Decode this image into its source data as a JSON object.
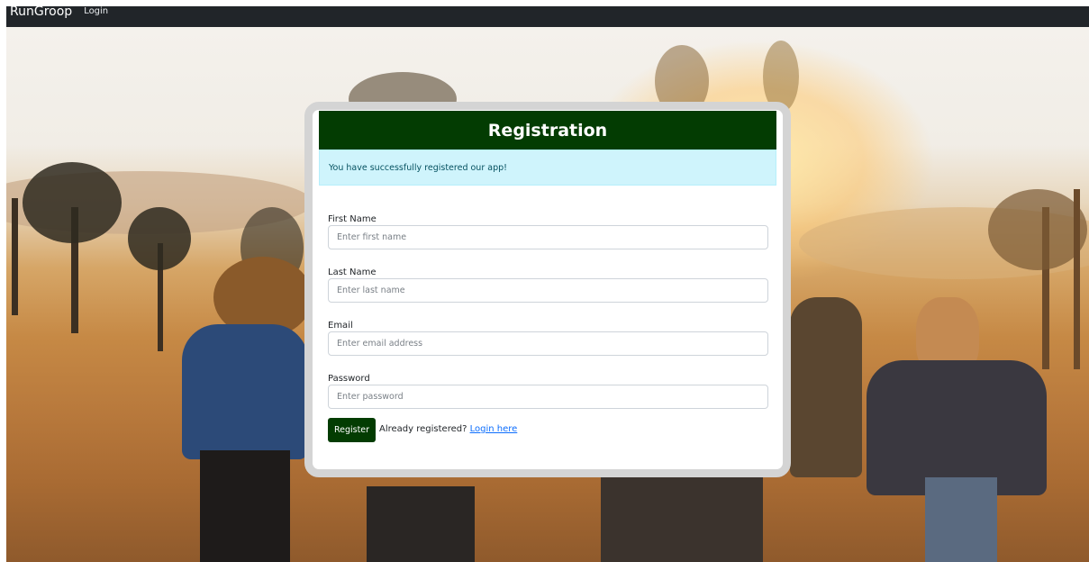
{
  "navbar": {
    "brand": "RunGroop",
    "links": [
      {
        "label": "Login"
      }
    ]
  },
  "registration": {
    "title": "Registration",
    "alert_message": "You have successfully registered our app!",
    "fields": [
      {
        "label": "First Name",
        "placeholder": "Enter first name",
        "value": ""
      },
      {
        "label": "Last Name",
        "placeholder": "Enter last name",
        "value": ""
      },
      {
        "label": "Email",
        "placeholder": "Enter email address",
        "value": ""
      },
      {
        "label": "Password",
        "placeholder": "Enter password",
        "value": ""
      }
    ],
    "submit_label": "Register",
    "login_prompt": "Already registered?",
    "login_link": "Login here"
  },
  "colors": {
    "navbar": "#212529",
    "header_green": "#033c02",
    "alert_bg": "#cff4fc",
    "link": "#0d6efd"
  }
}
